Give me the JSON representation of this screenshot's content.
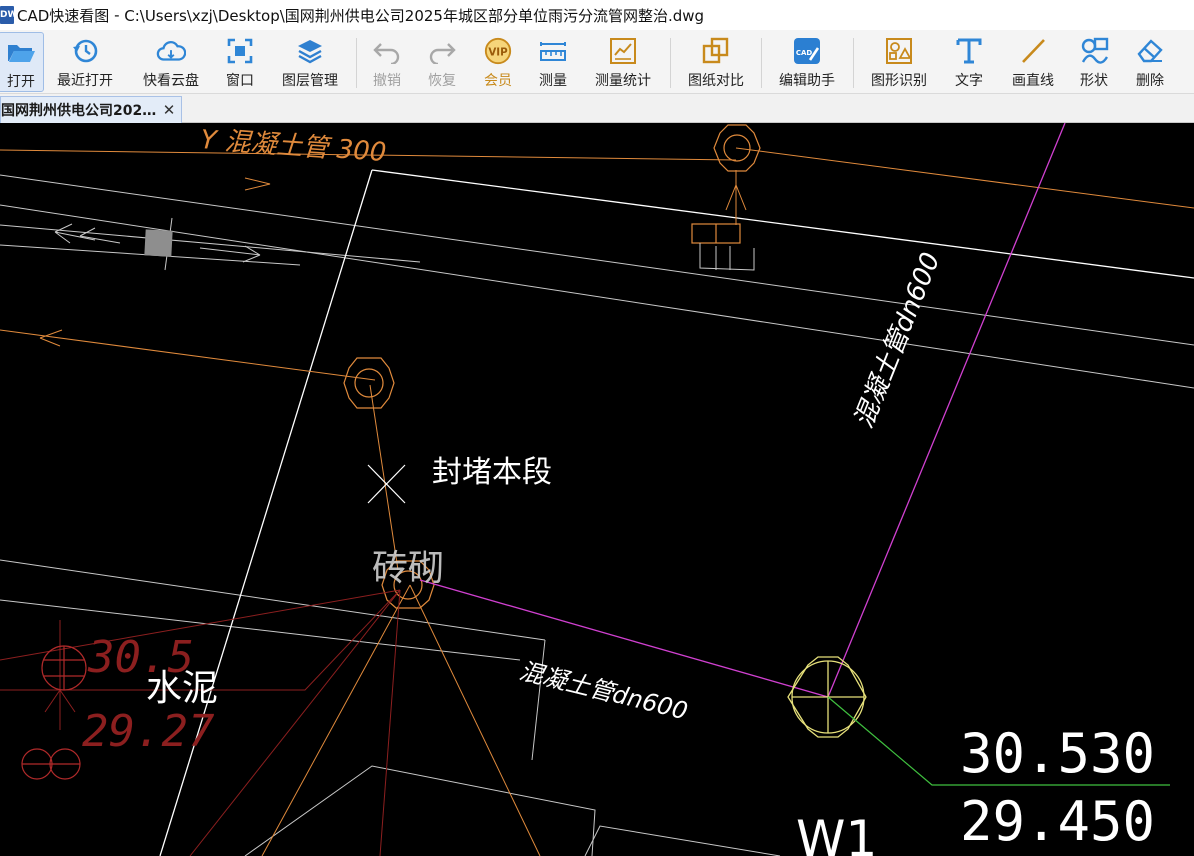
{
  "window": {
    "app_name": "CAD快速看图",
    "title_separator": " - ",
    "file_path": "C:\\Users\\xzj\\Desktop\\国网荆州供电公司2025年城区部分单位雨污分流管网整治.dwg",
    "app_icon_text": "DWG"
  },
  "toolbar": {
    "items": [
      {
        "label": "打开",
        "icon": "folder-open-icon"
      },
      {
        "label": "最近打开",
        "icon": "history-icon"
      },
      {
        "label": "快看云盘",
        "icon": "cloud-icon"
      },
      {
        "label": "窗口",
        "icon": "window-icon"
      },
      {
        "label": "图层管理",
        "icon": "layers-icon"
      },
      {
        "label": "撤销",
        "icon": "undo-icon"
      },
      {
        "label": "恢复",
        "icon": "redo-icon"
      },
      {
        "label": "会员",
        "icon": "vip-icon"
      },
      {
        "label": "测量",
        "icon": "ruler-icon"
      },
      {
        "label": "测量统计",
        "icon": "measure-stats-icon"
      },
      {
        "label": "图纸对比",
        "icon": "compare-icon"
      },
      {
        "label": "编辑助手",
        "icon": "edit-assistant-icon"
      },
      {
        "label": "图形识别",
        "icon": "shape-recognition-icon"
      },
      {
        "label": "文字",
        "icon": "text-icon"
      },
      {
        "label": "画直线",
        "icon": "line-icon"
      },
      {
        "label": "形状",
        "icon": "shapes-icon"
      },
      {
        "label": "删除",
        "icon": "eraser-icon"
      }
    ],
    "vip_text": "VIP",
    "cad_badge": "CAD"
  },
  "tabs": [
    {
      "label": "国网荆州供电公司202…",
      "close": "✕"
    }
  ],
  "drawing": {
    "annotations": {
      "top_pipe": "Y 混凝土管 300",
      "diag_pipe": "混凝土管dn600",
      "block_note": "封堵本段",
      "brick": "砖砌",
      "lower_pipe": "混凝土管dn600",
      "cement": "水泥",
      "left_elev_top": "30.5",
      "left_elev_bottom": "29.27",
      "elev_top": "30.530",
      "elev_bottom": "29.450",
      "well_id": "W1"
    },
    "colors": {
      "orange": "#e08a3c",
      "white": "#ffffff",
      "grey_line": "#c8c8c8",
      "magenta": "#d040d0",
      "yellow": "#e6e07a",
      "green": "#3fbf3f",
      "dark_red": "#8c1f1f",
      "red": "#b02a2a"
    }
  }
}
